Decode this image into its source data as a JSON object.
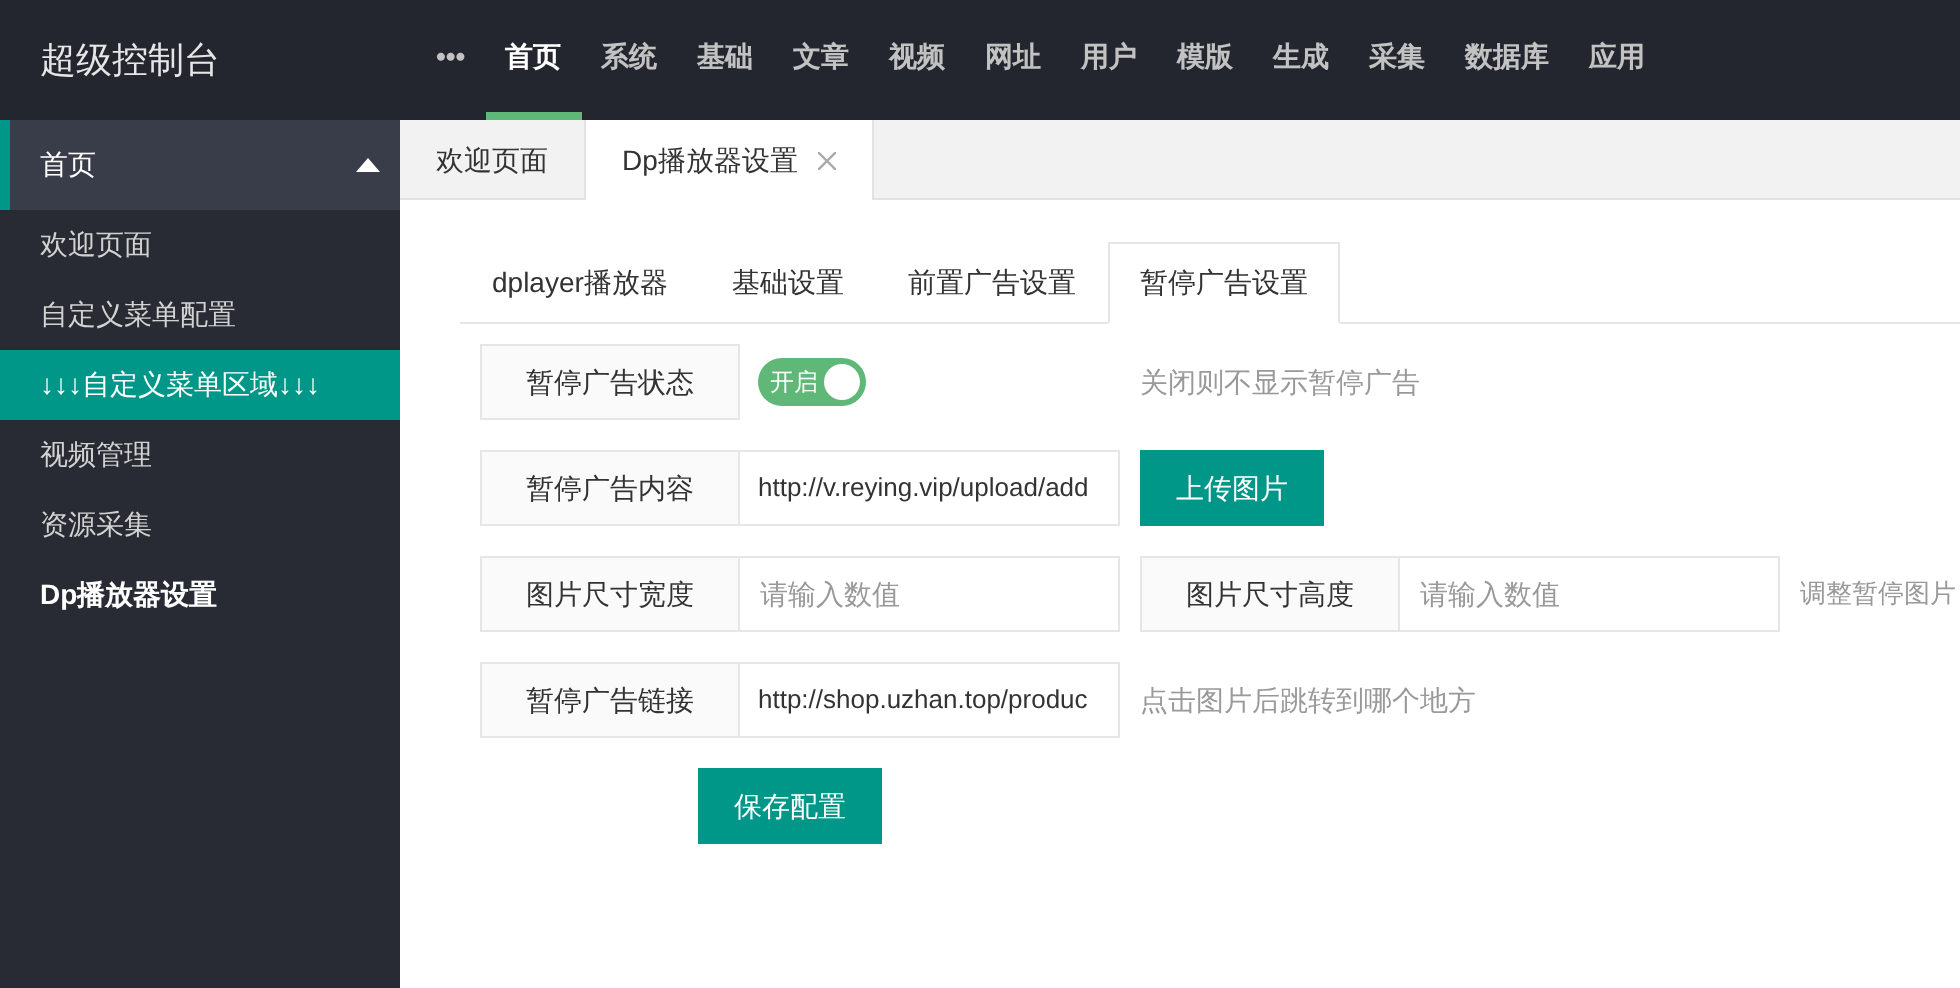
{
  "logo": "超级控制台",
  "nav": [
    {
      "label": "•••",
      "selected": false
    },
    {
      "label": "首页",
      "selected": true
    },
    {
      "label": "系统",
      "selected": false
    },
    {
      "label": "基础",
      "selected": false
    },
    {
      "label": "文章",
      "selected": false
    },
    {
      "label": "视频",
      "selected": false
    },
    {
      "label": "网址",
      "selected": false
    },
    {
      "label": "用户",
      "selected": false
    },
    {
      "label": "模版",
      "selected": false
    },
    {
      "label": "生成",
      "selected": false
    },
    {
      "label": "采集",
      "selected": false
    },
    {
      "label": "数据库",
      "selected": false
    },
    {
      "label": "应用",
      "selected": false
    }
  ],
  "sidebar": {
    "group": {
      "label": "首页",
      "expanded": true
    },
    "items": [
      {
        "label": "欢迎页面",
        "selected": false,
        "current": false
      },
      {
        "label": "自定义菜单配置",
        "selected": false,
        "current": false
      },
      {
        "label": "↓↓↓自定义菜单区域↓↓↓",
        "selected": true,
        "current": false
      },
      {
        "label": "视频管理",
        "selected": false,
        "current": false
      },
      {
        "label": "资源采集",
        "selected": false,
        "current": false
      },
      {
        "label": "Dp播放器设置",
        "selected": false,
        "current": true
      }
    ]
  },
  "page_tabs": [
    {
      "label": "欢迎页面",
      "selected": false,
      "closable": false
    },
    {
      "label": "Dp播放器设置",
      "selected": true,
      "closable": true
    }
  ],
  "sub_tabs": [
    {
      "label": "dplayer播放器",
      "selected": false
    },
    {
      "label": "基础设置",
      "selected": false
    },
    {
      "label": "前置广告设置",
      "selected": false
    },
    {
      "label": "暂停广告设置",
      "selected": true
    }
  ],
  "form": [
    {
      "kind": "switch",
      "label": "暂停广告状态",
      "switch_text": "开启",
      "on": true,
      "hint": "关闭则不显示暂停广告"
    },
    {
      "kind": "upload",
      "label": "暂停广告内容",
      "value": "http://v.reying.vip/upload/add",
      "button": "上传图片"
    },
    {
      "kind": "size",
      "label": "图片尺寸宽度",
      "placeholder": "请输入数值",
      "label2": "图片尺寸高度",
      "placeholder2": "请输入数值",
      "hint": "调整暂停图片"
    },
    {
      "kind": "link",
      "label": "暂停广告链接",
      "value": "http://shop.uzhan.top/produc",
      "hint": "点击图片后跳转到哪个地方"
    }
  ],
  "save_button": "保存配置"
}
